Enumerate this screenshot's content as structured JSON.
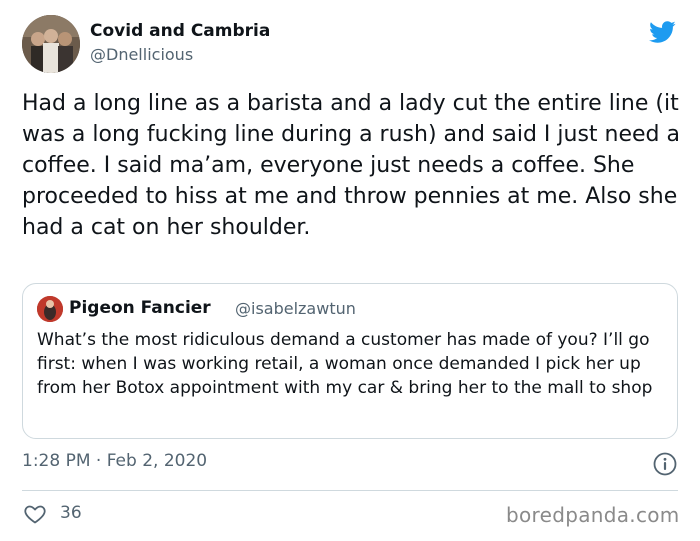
{
  "author": {
    "name": "Covid and Cambria",
    "handle": "@Dnellicious"
  },
  "tweet": {
    "text": "Had a long line as a barista and a lady cut the entire line (it was a long fucking line during a rush) and said I just need a coffee. I said ma’am, everyone just needs a coffee. She proceeded to hiss at me and throw pennies at me. Also she had a cat on her shoulder."
  },
  "quoted_tweet": {
    "name": "Pigeon Fancier",
    "handle": "@isabelzawtun",
    "text": "What’s the most ridiculous demand a customer has made of you? I’ll go first: when I was working retail, a woman once demanded I pick her up from her Botox appointment with my car & bring her to the mall to shop"
  },
  "meta": {
    "timestamp": "1:28 PM · Feb 2, 2020"
  },
  "actions": {
    "like_count": "36"
  },
  "watermark": "boredpanda.com",
  "icons": {
    "brand": "twitter-bird-icon",
    "info": "info-icon",
    "like": "heart-icon"
  },
  "colors": {
    "twitter_blue": "#1d9bf0",
    "secondary_text": "#536471",
    "border": "#cfd9de"
  }
}
